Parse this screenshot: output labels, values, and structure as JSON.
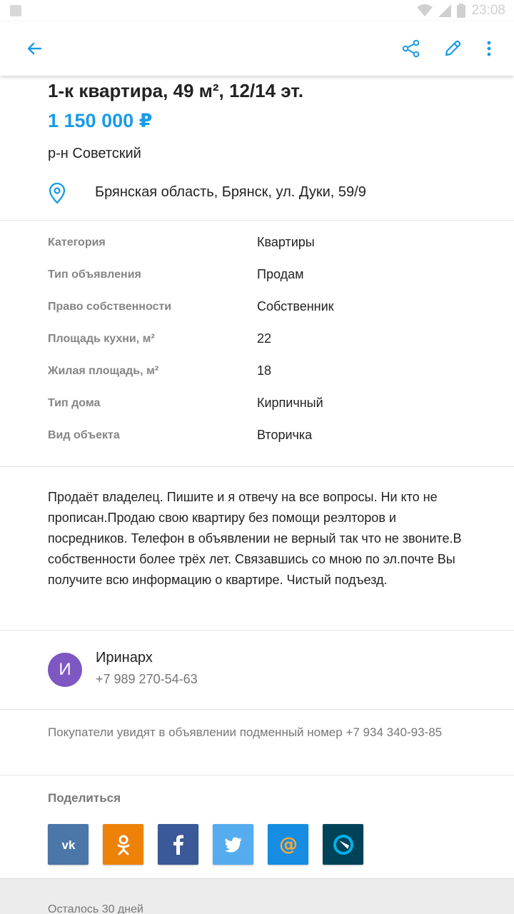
{
  "status_bar": {
    "time": "23:08"
  },
  "toolbar": {
    "back_icon": "arrow-left-icon",
    "share_icon": "share-icon",
    "edit_icon": "pencil-icon",
    "menu_icon": "more-vertical-icon",
    "accent_color": "#1a9be6"
  },
  "listing": {
    "title": "1-к квартира, 49 м², 12/14 эт.",
    "price": "1 150 000 ₽",
    "district": "р-н Советский",
    "address": "Брянская область, Брянск, ул. Дуки, 59/9"
  },
  "params": [
    {
      "name": "Категория",
      "value": "Квартиры"
    },
    {
      "name": "Тип объявления",
      "value": "Продам"
    },
    {
      "name": "Право собственности",
      "value": "Собственник"
    },
    {
      "name": "Площадь кухни, м²",
      "value": "22"
    },
    {
      "name": "Жилая площадь, м²",
      "value": "18"
    },
    {
      "name": "Тип дома",
      "value": "Кирпичный"
    },
    {
      "name": "Вид объекта",
      "value": "Вторичка"
    }
  ],
  "description": "Продаёт владелец. Пишите и я отвечу на все вопросы. Ни кто не прописан.Продаю свою квартиру без помощи реэлторов и посредников. Телефон в объявлении не верный так что не звоните.В собственности более трёх лет. Связавшись со мною по эл.почте Вы получите всю информацию о квартире. Чистый подъезд.",
  "seller": {
    "initial": "И",
    "name": "Иринарх",
    "phone": "+7 989 270-54-63",
    "avatar_color": "#7e57c2"
  },
  "notice": "Покупатели увидят в объявлении подменный номер +7 934 340-93-85",
  "share": {
    "title": "Поделиться",
    "buttons": [
      {
        "network": "vk",
        "icon": "vk-icon",
        "color": "#4a76a8"
      },
      {
        "network": "odnoklassniki",
        "icon": "odnoklassniki-icon",
        "color": "#ee8208"
      },
      {
        "network": "facebook",
        "icon": "facebook-icon",
        "color": "#3b5998"
      },
      {
        "network": "twitter",
        "icon": "twitter-icon",
        "color": "#55acee"
      },
      {
        "network": "mail",
        "icon": "mail-at-icon",
        "color": "#168de2"
      },
      {
        "network": "livejournal",
        "icon": "livejournal-icon",
        "color": "#004359"
      }
    ]
  },
  "footer": {
    "remaining": "Осталось 30 дней"
  }
}
